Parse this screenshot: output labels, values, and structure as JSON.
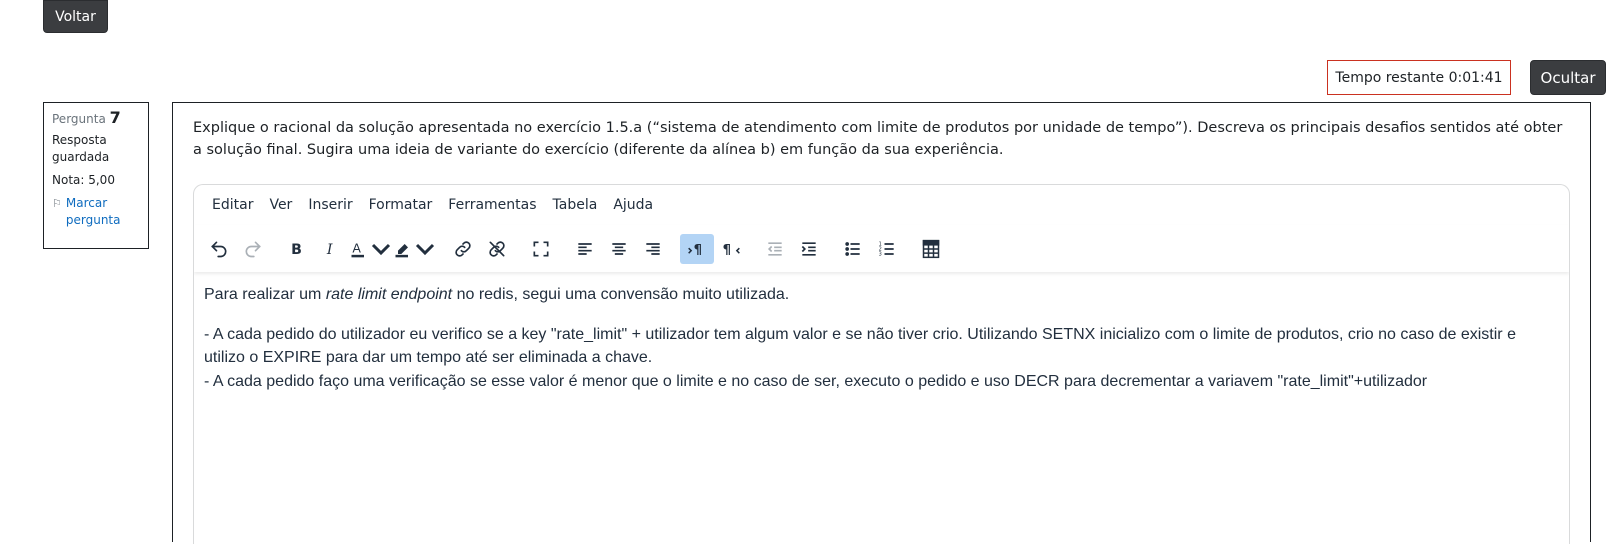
{
  "nav": {
    "back_label": "Voltar"
  },
  "timer": {
    "label": "Tempo restante",
    "value": "0:01:41",
    "hide_label": "Ocultar"
  },
  "question_info": {
    "label": "Pergunta",
    "number": "7",
    "state": "Resposta guardada",
    "grade": "Nota: 5,00",
    "flag_label": "Marcar pergunta"
  },
  "question": {
    "text": "Explique o racional da solução apresentada no exercício 1.5.a (“sistema de atendimento com limite de produtos por unidade de tempo”). Descreva os principais desafios sentidos até obter a solução final. Sugira uma ideia de variante do exercício (diferente da alínea b) em função da sua experiência."
  },
  "editor": {
    "menu": [
      "Editar",
      "Ver",
      "Inserir",
      "Formatar",
      "Ferramentas",
      "Tabela",
      "Ajuda"
    ],
    "toolbar_icons": [
      "undo-icon",
      "redo-icon",
      "bold-icon",
      "italic-icon",
      "text-color-icon",
      "highlight-color-icon",
      "link-icon",
      "unlink-icon",
      "fullscreen-icon",
      "align-left-icon",
      "align-center-icon",
      "align-right-icon",
      "ltr-icon",
      "rtl-icon",
      "outdent-icon",
      "indent-icon",
      "bullet-list-icon",
      "numbered-list-icon",
      "calculator-icon"
    ],
    "content": {
      "p1_a": "Para realizar um ",
      "p1_em": "rate limit endpoint",
      "p1_b": " no redis, segui uma convensão muito utilizada.",
      "p2_l1": "- A cada pedido do utilizador eu verifico se a key \"rate_limit\" + utilizador tem algum valor e se não tiver crio. Utilizando SETNX inicializo com o limite de produtos, crio no caso de existir e utilizo o EXPIRE para dar um tempo até ser eliminada a chave.",
      "p2_l2": "- A cada pedido faço uma verificação se esse valor é menor que o limite e no caso de ser, executo o pedido e uso DECR para decrementar a variavem \"rate_limit\"+utilizador"
    }
  }
}
